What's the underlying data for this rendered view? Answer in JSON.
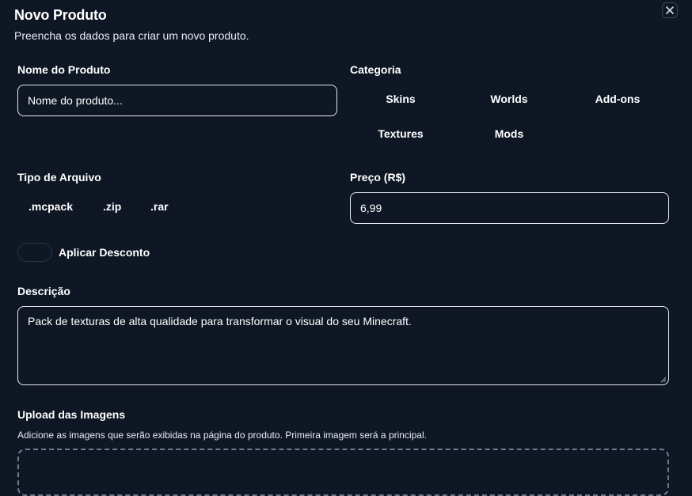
{
  "dialog": {
    "title": "Novo Produto",
    "subtitle": "Preencha os dados para criar um novo produto."
  },
  "name_field": {
    "label": "Nome do Produto",
    "placeholder": "Nome do produto..."
  },
  "category": {
    "label": "Categoria",
    "options": [
      "Skins",
      "Worlds",
      "Add-ons",
      "Textures",
      "Mods"
    ]
  },
  "file_type": {
    "label": "Tipo de Arquivo",
    "options": [
      ".mcpack",
      ".zip",
      ".rar"
    ]
  },
  "price": {
    "label": "Preço (R$)",
    "value": "6,99"
  },
  "discount": {
    "label": "Aplicar Desconto"
  },
  "description": {
    "label": "Descrição",
    "value": "Pack de texturas de alta qualidade para transformar o visual do seu Minecraft."
  },
  "upload": {
    "label": "Upload das Imagens",
    "help": "Adicione as imagens que serão exibidas na página do produto. Primeira imagem será a principal."
  },
  "icons": {
    "close": "close-icon",
    "resize": "resize-grip-icon"
  }
}
